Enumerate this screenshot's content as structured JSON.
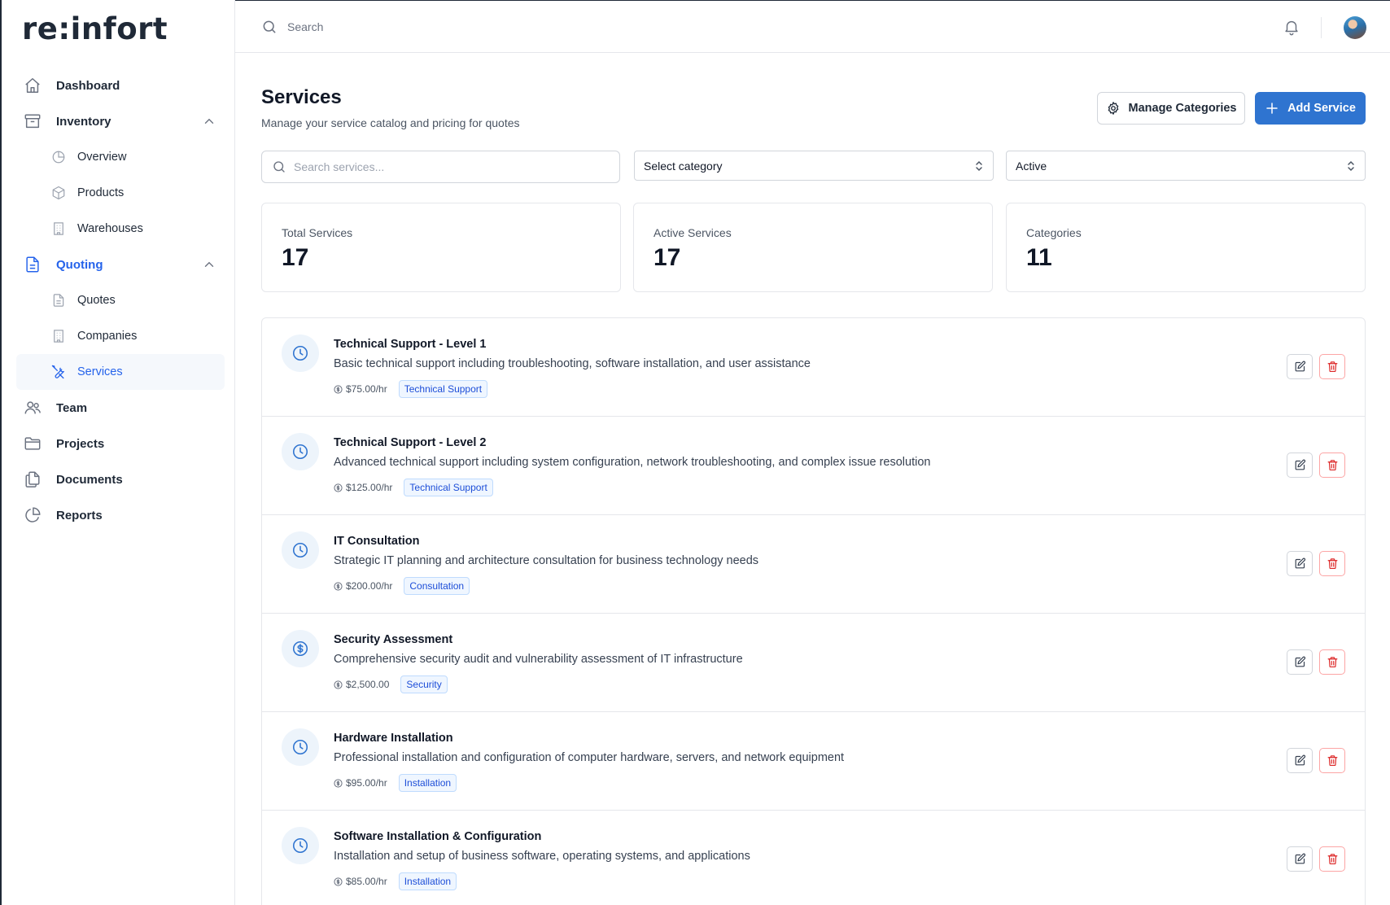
{
  "app": {
    "logo": "re:infort"
  },
  "topbar": {
    "search_placeholder": "Search"
  },
  "sidebar": {
    "items": [
      {
        "label": "Dashboard"
      },
      {
        "label": "Inventory",
        "children": [
          {
            "label": "Overview"
          },
          {
            "label": "Products"
          },
          {
            "label": "Warehouses"
          }
        ]
      },
      {
        "label": "Quoting",
        "children": [
          {
            "label": "Quotes"
          },
          {
            "label": "Companies"
          },
          {
            "label": "Services"
          }
        ]
      },
      {
        "label": "Team"
      },
      {
        "label": "Projects"
      },
      {
        "label": "Documents"
      },
      {
        "label": "Reports"
      }
    ]
  },
  "page": {
    "title": "Services",
    "subtitle": "Manage your service catalog and pricing for quotes",
    "manage_label": "Manage Categories",
    "add_label": "Add Service"
  },
  "filters": {
    "search_placeholder": "Search services...",
    "category_value": "Select category",
    "status_value": "Active"
  },
  "stats": [
    {
      "label": "Total Services",
      "value": "17"
    },
    {
      "label": "Active Services",
      "value": "17"
    },
    {
      "label": "Categories",
      "value": "11"
    }
  ],
  "services": [
    {
      "name": "Technical Support - Level 1",
      "description": "Basic technical support including troubleshooting, software installation, and user assistance",
      "price": "$75.00/hr",
      "category": "Technical Support",
      "icon": "clock-icon"
    },
    {
      "name": "Technical Support - Level 2",
      "description": "Advanced technical support including system configuration, network troubleshooting, and complex issue resolution",
      "price": "$125.00/hr",
      "category": "Technical Support",
      "icon": "clock-icon"
    },
    {
      "name": "IT Consultation",
      "description": "Strategic IT planning and architecture consultation for business technology needs",
      "price": "$200.00/hr",
      "category": "Consultation",
      "icon": "clock-icon"
    },
    {
      "name": "Security Assessment",
      "description": "Comprehensive security audit and vulnerability assessment of IT infrastructure",
      "price": "$2,500.00",
      "category": "Security",
      "icon": "dollar-icon"
    },
    {
      "name": "Hardware Installation",
      "description": "Professional installation and configuration of computer hardware, servers, and network equipment",
      "price": "$95.00/hr",
      "category": "Installation",
      "icon": "clock-icon"
    },
    {
      "name": "Software Installation & Configuration",
      "description": "Installation and setup of business software, operating systems, and applications",
      "price": "$85.00/hr",
      "category": "Installation",
      "icon": "clock-icon"
    }
  ],
  "colors": {
    "accent": "#2f74d0",
    "danger": "#dc2626"
  }
}
